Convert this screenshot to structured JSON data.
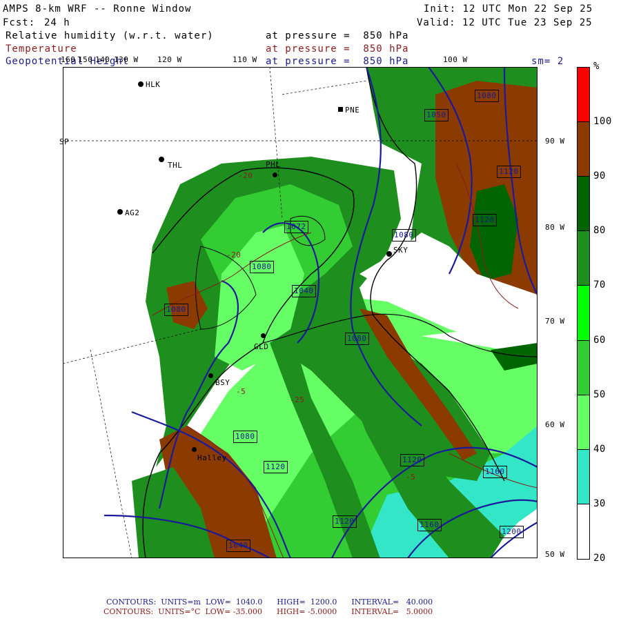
{
  "header": {
    "title": "AMPS 8-km WRF -- Ronne Window",
    "fcst_label": "Fcst:",
    "fcst_value": "24 h",
    "init": "Init: 12 UTC Mon 22 Sep 25",
    "valid": "Valid: 12 UTC Tue 23 Sep 25",
    "field1": "Relative humidity (w.r.t. water)",
    "field2": "Temperature",
    "field3": "Geopotential Height",
    "pressure_text": "at pressure =  850 hPa",
    "smoothing": "sm= 2"
  },
  "longitudes": [
    "160",
    "150",
    "140",
    "130 W",
    "120 W",
    "110 W",
    "100 W"
  ],
  "latitudes": [
    "90 W",
    "80 W",
    "70 W",
    "60 W",
    "50 W"
  ],
  "stations": [
    {
      "id": "HLK"
    },
    {
      "id": "PNE"
    },
    {
      "id": "THL"
    },
    {
      "id": "PHL"
    },
    {
      "id": "AG2"
    },
    {
      "id": "SKY"
    },
    {
      "id": "GLD"
    },
    {
      "id": "BSY"
    },
    {
      "id": "Halley"
    }
  ],
  "station_label_sp": "SP",
  "contour_labels_height": [
    "1080",
    "1050",
    "1120",
    "1120",
    "1072",
    "1080",
    "1080",
    "1040",
    "1080",
    "1080",
    "1080",
    "1120",
    "1160",
    "1160",
    "1200",
    "1120",
    "1040"
  ],
  "contour_labels_temp": [
    "-20",
    "-25",
    "-10",
    "-5",
    "-15"
  ],
  "colorbar": {
    "unit": "%",
    "ticks": [
      "100",
      "90",
      "80",
      "70",
      "60",
      "50",
      "40",
      "30",
      "20"
    ],
    "colors": [
      "#ff0000",
      "#8b3a00",
      "#006400",
      "#1e8f1e",
      "#00ff00",
      "#33cc33",
      "#66ff66",
      "#33e6c8",
      "#ffffff"
    ]
  },
  "footer": {
    "line1_label": "CONTOURS:",
    "line1_units": "UNITS=m",
    "line1_low": "LOW=  1040.0",
    "line1_high": "HIGH=  1200.0",
    "line1_interval": "INTERVAL=   40.000",
    "line2_label": "CONTOURS:",
    "line2_units": "UNITS=°C",
    "line2_low": "LOW= -35.000",
    "line2_high": "HIGH= -5.0000",
    "line2_interval": "INTERVAL=   5.0000"
  }
}
